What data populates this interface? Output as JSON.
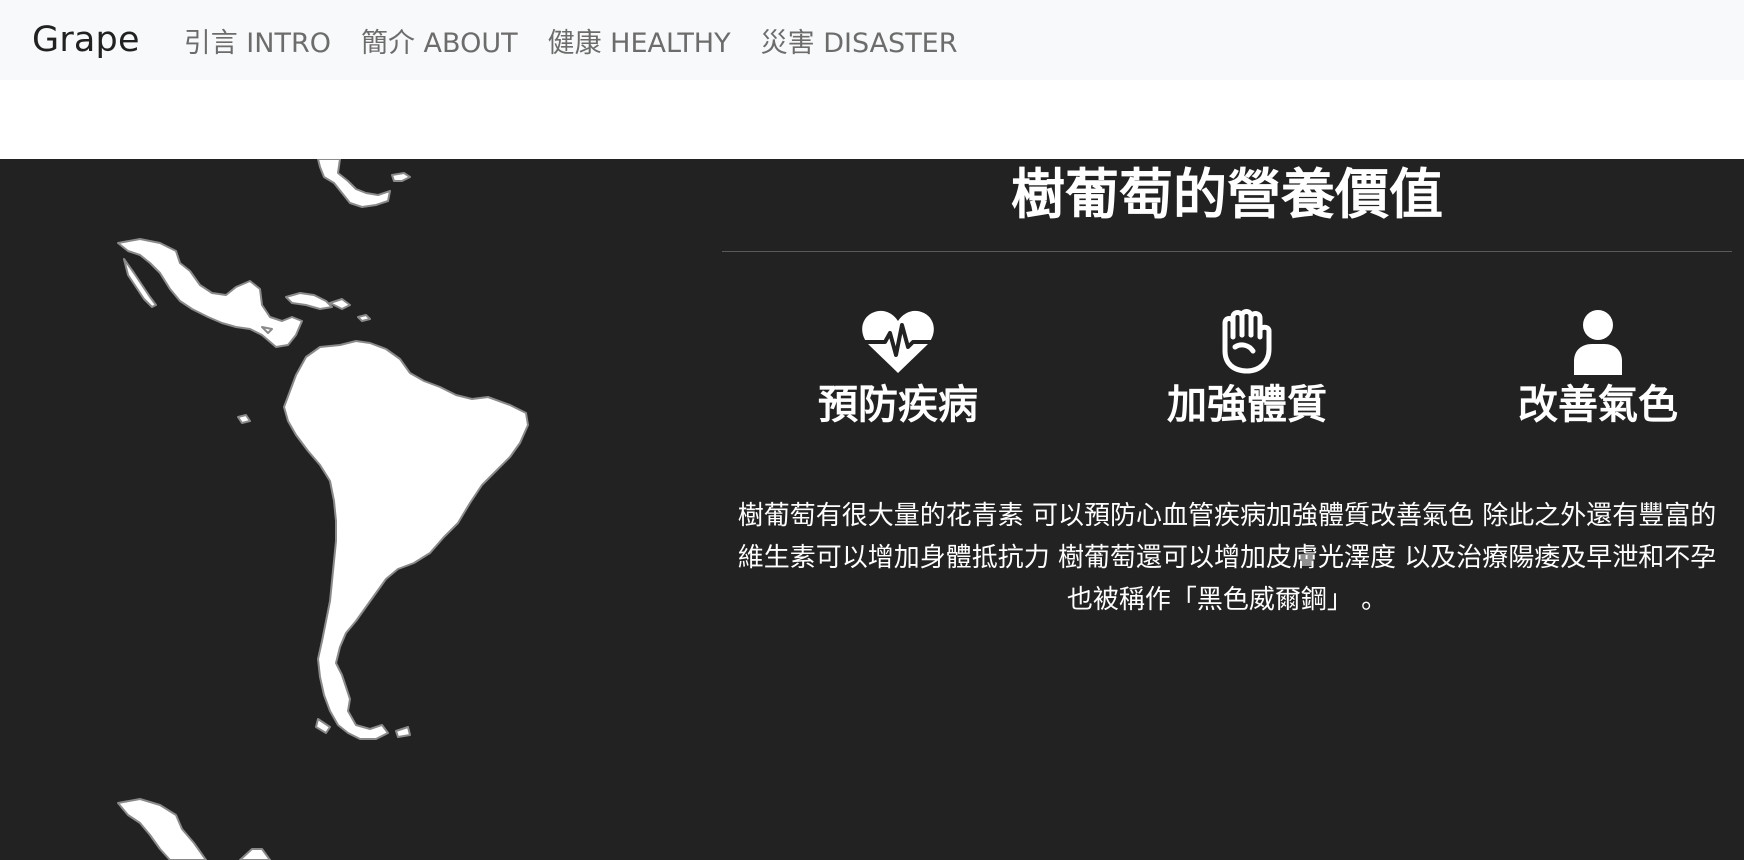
{
  "navbar": {
    "brand": "Grape",
    "links": [
      "引言 INTRO",
      "簡介 ABOUT",
      "健康 HEALTHY",
      "災害 DISASTER"
    ]
  },
  "main": {
    "title": "樹葡萄的營養價值",
    "features": [
      {
        "label": "預防疾病",
        "icon": "heartbeat-icon"
      },
      {
        "label": "加強體質",
        "icon": "fist-icon"
      },
      {
        "label": "改善氣色",
        "icon": "user-icon"
      }
    ],
    "description": "樹葡萄有很大量的花青素 可以預防心血管疾病加強體質改善氣色 除此之外還有豐富的維生素可以增加身體抵抗力 樹葡萄還可以增加皮膚光澤度 以及治療陽痿及早泄和不孕也被稱作「黑色威爾鋼」 。"
  },
  "colors": {
    "navbar_bg": "#f8f9fa",
    "section_bg": "#222222",
    "text_light": "#ffffff",
    "nav_link": "#6c6c6c"
  }
}
